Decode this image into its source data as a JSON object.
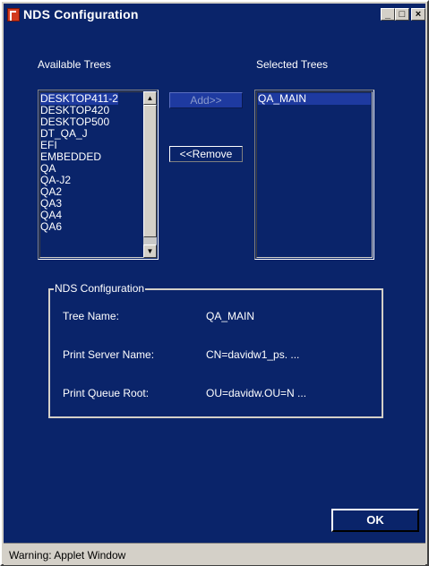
{
  "window": {
    "title": "NDS Configuration"
  },
  "available": {
    "label": "Available Trees",
    "items": [
      "DESKTOP411-2",
      "DESKTOP420",
      "DESKTOP500",
      "DT_QA_J",
      "EFI",
      "EMBEDDED",
      "QA",
      "QA-J2",
      "QA2",
      "QA3",
      "QA4",
      "QA6"
    ]
  },
  "selected": {
    "label": "Selected Trees",
    "items": [
      "QA_MAIN"
    ]
  },
  "buttons": {
    "add": "Add>>",
    "remove": "<<Remove",
    "ok": "OK"
  },
  "nds": {
    "title": "NDS Configuration",
    "tree_name_label": "Tree Name:",
    "tree_name_value": "QA_MAIN",
    "print_server_label": "Print Server Name:",
    "print_server_value": "CN=davidw1_ps.  ...",
    "print_queue_label": "Print Queue Root:",
    "print_queue_value": "OU=davidw.OU=N  ..."
  },
  "status": {
    "text": "Warning: Applet Window"
  },
  "colors": {
    "client_bg": "#0a246a",
    "title_bg": "#0a246a",
    "chrome": "#d4d0c8"
  }
}
